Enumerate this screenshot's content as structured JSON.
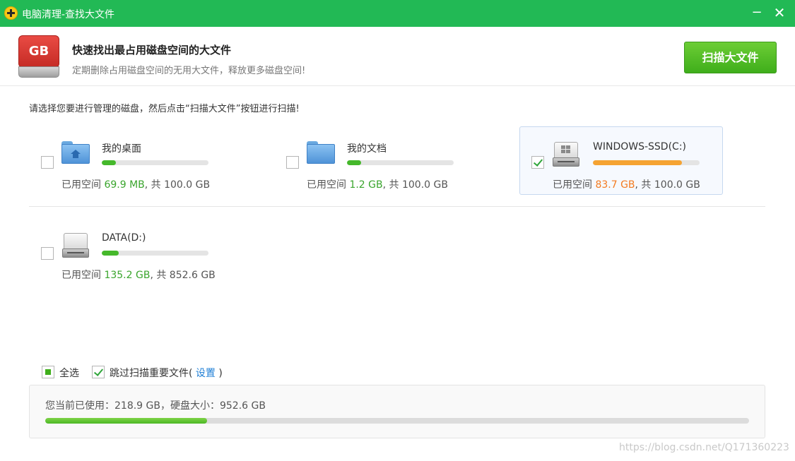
{
  "window": {
    "title": "电脑清理-查找大文件",
    "minimize": "−",
    "close": "✕"
  },
  "header": {
    "icon_text": "GB",
    "title": "快速找出最占用磁盘空间的大文件",
    "subtitle": "定期删除占用磁盘空间的无用大文件，释放更多磁盘空间!",
    "scan_button": "扫描大文件"
  },
  "instruction": "请选择您要进行管理的磁盘，然后点击“扫描大文件”按钮进行扫描!",
  "drives": [
    {
      "name": "我的桌面",
      "icon": "home-folder-icon",
      "used_prefix": "已用空间 ",
      "used": "69.9 MB",
      "total_text": ", 共 100.0 GB",
      "fraction": 0.13,
      "checked": false,
      "color": "green"
    },
    {
      "name": "我的文档",
      "icon": "folder-icon",
      "used_prefix": "已用空间 ",
      "used": "1.2 GB",
      "total_text": ", 共 100.0 GB",
      "fraction": 0.13,
      "checked": false,
      "color": "green"
    },
    {
      "name": "WINDOWS-SSD(C:)",
      "icon": "windows-drive-icon",
      "used_prefix": "已用空间 ",
      "used": "83.7 GB",
      "total_text": ", 共 100.0 GB",
      "fraction": 0.837,
      "checked": true,
      "color": "orange"
    },
    {
      "name": "DATA(D:)",
      "icon": "hard-drive-icon",
      "used_prefix": "已用空间 ",
      "used": "135.2 GB",
      "total_text": ", 共 852.6 GB",
      "fraction": 0.159,
      "checked": false,
      "color": "green"
    }
  ],
  "footer": {
    "select_all": "全选",
    "skip_label": "跳过扫描重要文件(",
    "settings_link": "设置",
    "skip_suffix": ")",
    "summary": "您当前已使用：218.9 GB，硬盘大小：952.6 GB",
    "summary_fraction": 0.23
  },
  "watermark": "https://blog.csdn.net/Q171360223",
  "colors": {
    "titlebar": "#22b955",
    "accent_green": "#45b82b",
    "accent_orange": "#f5a332",
    "link": "#1f7fd6"
  }
}
